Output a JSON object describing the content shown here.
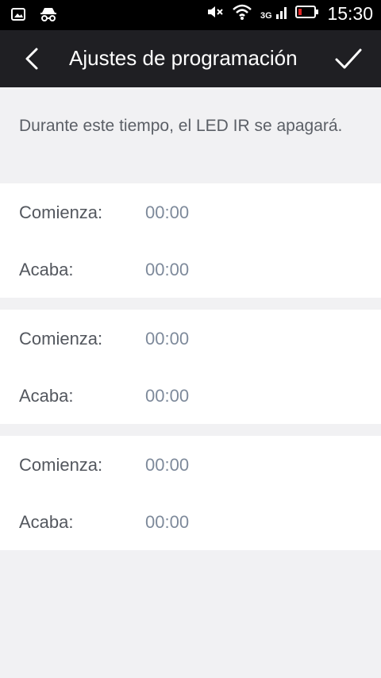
{
  "status_bar": {
    "time": "15:30",
    "icons": [
      "image-icon",
      "incognito-icon",
      "mute-icon",
      "wifi-icon",
      "signal-3g-icon",
      "battery-icon"
    ],
    "battery_color": "#e02424"
  },
  "header": {
    "title": "Ajustes de programación",
    "back_icon": "back-chevron-icon",
    "confirm_icon": "check-icon"
  },
  "description": "Durante este tiempo, el LED IR se apagará.",
  "schedules": [
    {
      "start_label": "Comienza:",
      "start_value": "00:00",
      "end_label": "Acaba:",
      "end_value": "00:00"
    },
    {
      "start_label": "Comienza:",
      "start_value": "00:00",
      "end_label": "Acaba:",
      "end_value": "00:00"
    },
    {
      "start_label": "Comienza:",
      "start_value": "00:00",
      "end_label": "Acaba:",
      "end_value": "00:00"
    }
  ],
  "colors": {
    "header_bg": "#1f1f23",
    "page_bg": "#f1f1f3",
    "value_text": "#7e8a9b"
  }
}
